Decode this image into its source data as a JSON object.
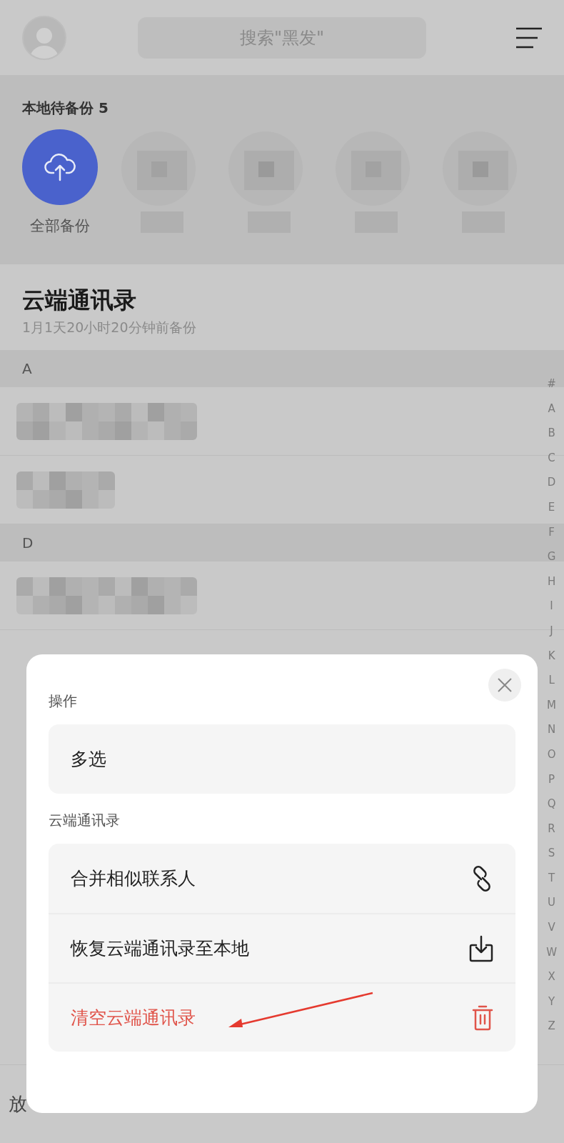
{
  "header": {
    "search": {
      "placeholder": "搜索\"黑发\""
    }
  },
  "local_backup": {
    "title": "本地待备份 5",
    "backup_all_label": "全部备份"
  },
  "cloud": {
    "title": "云端通讯录",
    "subtitle": "1月1天20小时20分钟前备份"
  },
  "sections": [
    {
      "letter": "A"
    },
    {
      "letter": "D"
    }
  ],
  "index": [
    "#",
    "A",
    "B",
    "C",
    "D",
    "E",
    "F",
    "G",
    "H",
    "I",
    "J",
    "K",
    "L",
    "M",
    "N",
    "O",
    "P",
    "Q",
    "R",
    "S",
    "T",
    "U",
    "V",
    "W",
    "X",
    "Y",
    "Z"
  ],
  "bottom_bar": {
    "text": "放"
  },
  "sheet": {
    "groups": [
      {
        "label": "操作",
        "items": [
          {
            "label": "多选",
            "kind": "plain"
          }
        ]
      },
      {
        "label": "云端通讯录",
        "items": [
          {
            "label": "合并相似联系人",
            "kind": "link"
          },
          {
            "label": "恢复云端通讯录至本地",
            "kind": "download"
          },
          {
            "label": "清空云端通讯录",
            "kind": "delete"
          }
        ]
      }
    ]
  }
}
